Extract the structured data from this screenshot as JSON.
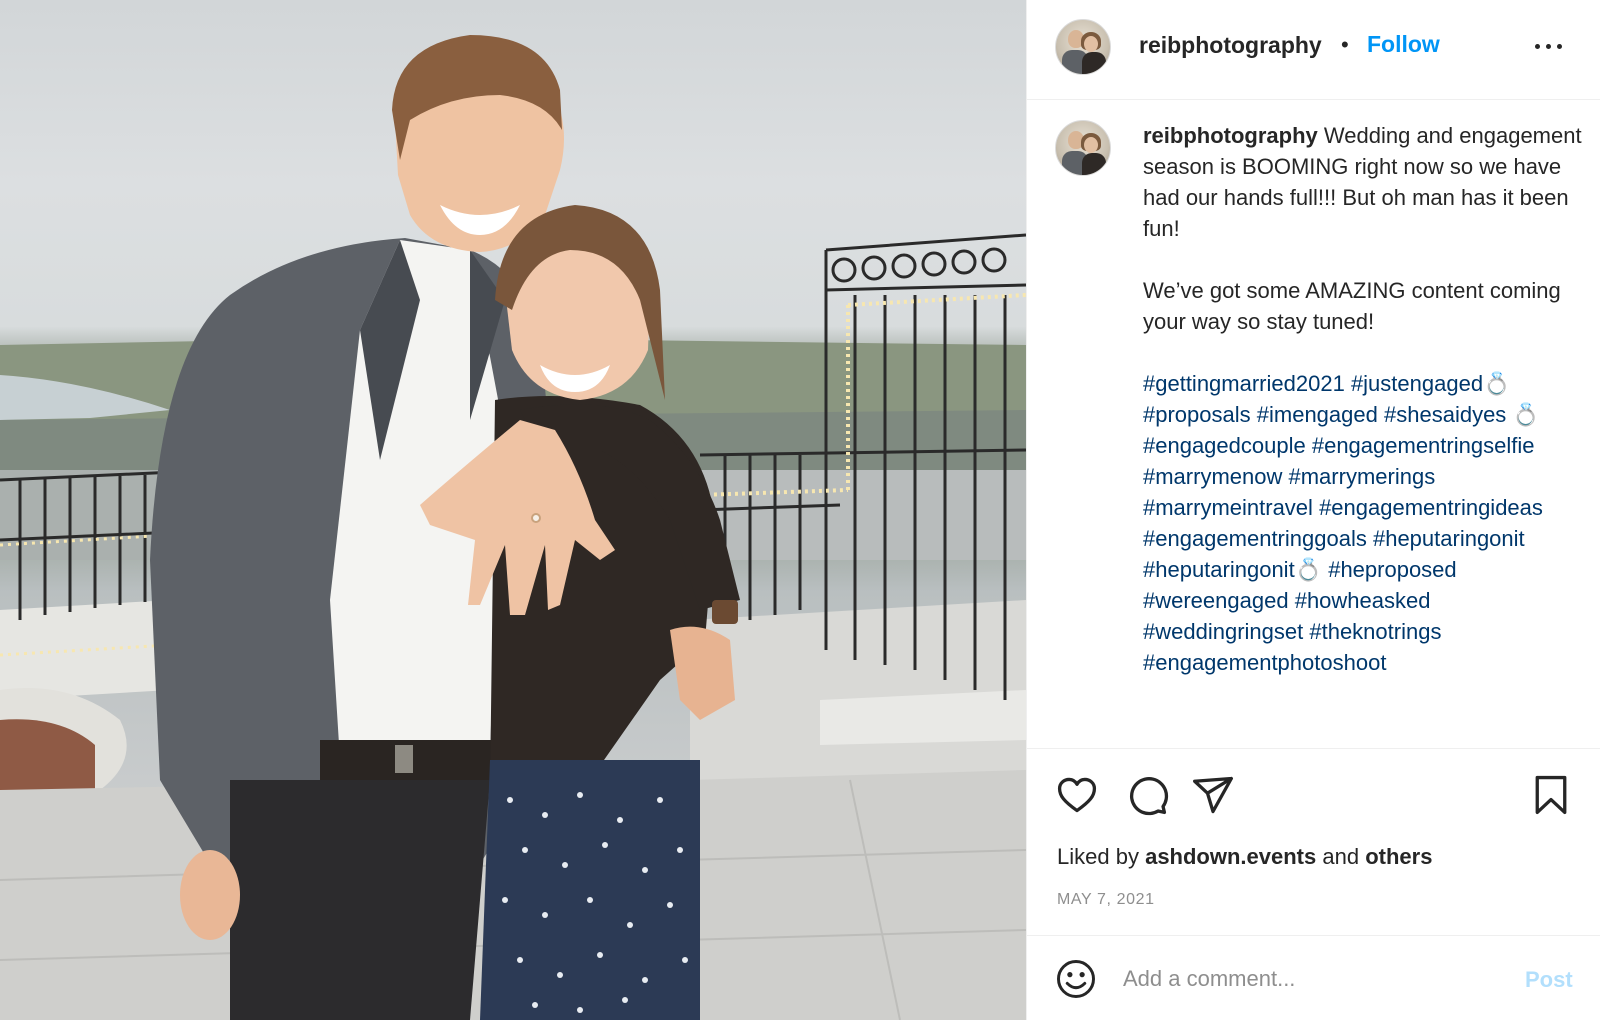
{
  "post": {
    "username": "reibphotography",
    "follow_label": "Follow",
    "separator": "•",
    "caption": {
      "username": "reibphotography",
      "paragraph1": "Wedding and engagement season is BOOMING right now so we have had our hands full!!! But oh man has it been fun!",
      "paragraph2": "We’ve got some AMAZING content coming your way so stay tuned!",
      "hashtags": [
        "#gettingmarried2021",
        "#justengaged💍",
        "#proposals",
        "#imengaged",
        "#shesaidyes 💍",
        "#engagedcouple",
        "#engagementringselfie",
        "#marrymenow",
        "#marrymerings",
        "#marrymeintravel",
        "#engagementringideas",
        "#engagementringgoals",
        "#heputaringonit",
        "#heputaringonit💍",
        "#heproposed",
        "#wereengaged",
        "#howheasked",
        "#weddingringset",
        "#theknotrings",
        "#engagementphotoshoot"
      ]
    },
    "likes": {
      "prefix": "Liked by",
      "user": "ashdown.events",
      "conjunction": "and",
      "others": "others"
    },
    "date": "MAY 7, 2021",
    "comment": {
      "placeholder": "Add a comment...",
      "post_label": "Post"
    },
    "icons": {
      "more": "more-options-icon",
      "like": "heart-icon",
      "comment": "comment-icon",
      "share": "paper-plane-icon",
      "save": "bookmark-icon",
      "emoji": "smiley-icon"
    },
    "colors": {
      "follow": "#0095f6",
      "hashtag": "#00376b",
      "post_disabled": "#b2dffc",
      "muted": "#8e8e8e",
      "text": "#262626"
    }
  }
}
